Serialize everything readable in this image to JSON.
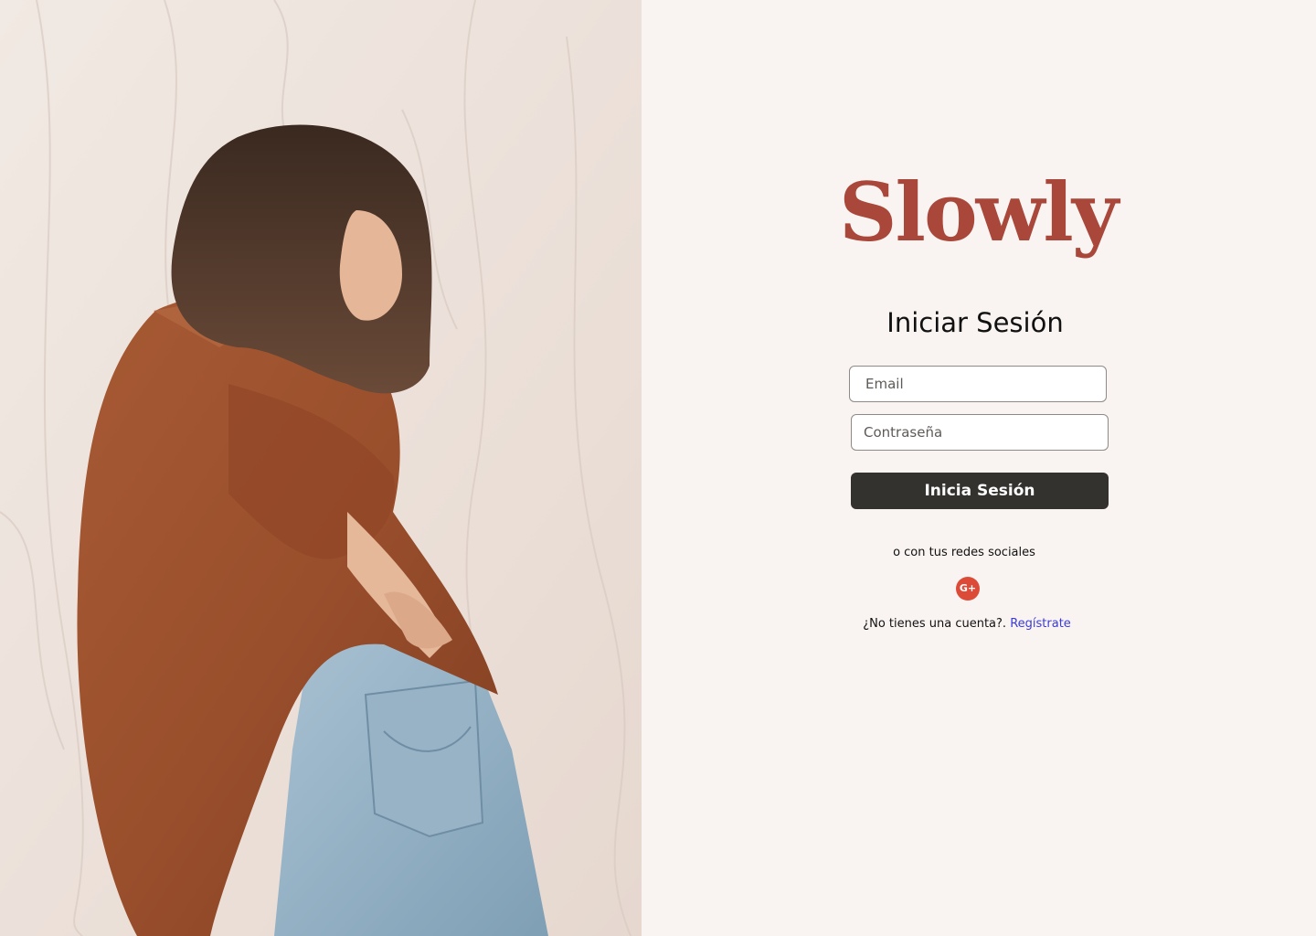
{
  "photo": {
    "alt": "Woman wearing a rust-colored linen shirt and light blue jeans against a wrinkled cream backdrop"
  },
  "brand": {
    "name": "Slowly",
    "color": "#a8473a"
  },
  "login": {
    "title": "Iniciar Sesión",
    "email_placeholder": "Email",
    "password_placeholder": "Contraseña",
    "submit_label": "Inicia Sesión",
    "social_caption": "o con tus redes sociales",
    "google_label": "G+",
    "signup_prompt": "¿No tienes una cuenta?.",
    "signup_link": "Regístrate"
  },
  "colors": {
    "background": "#f9f4f1",
    "button": "#34322f",
    "google": "#dc4a38",
    "link": "#3b3bd6"
  }
}
